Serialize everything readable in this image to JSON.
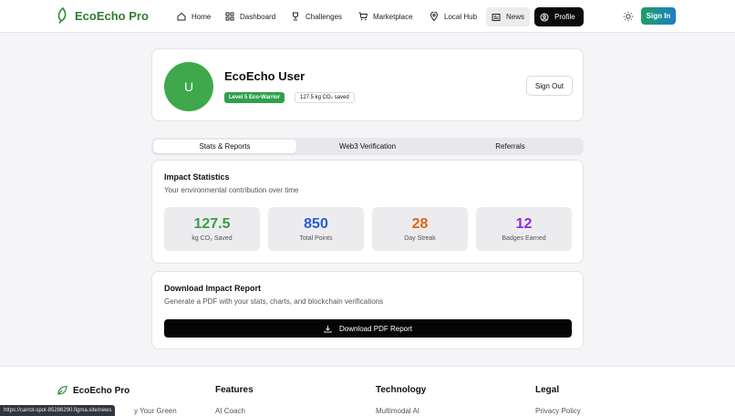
{
  "nav": {
    "brand": "EcoEcho Pro",
    "items": [
      {
        "label": "Home",
        "icon": "home-icon"
      },
      {
        "label": "Dashboard",
        "icon": "grid-icon"
      },
      {
        "label": "Challenges",
        "icon": "trophy-icon"
      },
      {
        "label": "Marketplace",
        "icon": "cart-icon"
      },
      {
        "label": "Local Hub",
        "icon": "map-pin-icon"
      },
      {
        "label": "News",
        "icon": "newspaper-icon"
      },
      {
        "label": "Profile",
        "icon": "user-circle-icon"
      }
    ],
    "sign_in": "Sign In",
    "accent_gradient": [
      "#1f9e62",
      "#1e7fc8"
    ]
  },
  "profile": {
    "avatar_letter": "U",
    "name": "EcoEcho User",
    "level_badge": "Level 5 Eco-Warrior",
    "co2_badge": "127.5 kg CO₂ saved",
    "sign_out": "Sign Out"
  },
  "tabs": [
    "Stats & Reports",
    "Web3 Verification",
    "Referrals"
  ],
  "impact": {
    "title": "Impact Statistics",
    "subtitle": "Your environmental contribution over time",
    "stats": [
      {
        "value": "127.5",
        "label": "kg CO₂ Saved",
        "color": "#3a9d45"
      },
      {
        "value": "850",
        "label": "Total Points",
        "color": "#2a5bd7"
      },
      {
        "value": "28",
        "label": "Day Streak",
        "color": "#e0651a"
      },
      {
        "value": "12",
        "label": "Badges Earned",
        "color": "#8a2be2"
      }
    ]
  },
  "report": {
    "title": "Download Impact Report",
    "subtitle": "Generate a PDF with your stats, charts, and blockchain verifications",
    "button": "Download PDF Report"
  },
  "footer": {
    "brand": "EcoEcho Pro",
    "tagline": "y Your Green",
    "columns": [
      {
        "title": "Features",
        "first_link": "AI Coach"
      },
      {
        "title": "Technology",
        "first_link": "Multimodal AI"
      },
      {
        "title": "Legal",
        "first_link": "Privacy Policy"
      }
    ]
  },
  "status_url": "https://carrot-spot-85286290.figma.site/news"
}
